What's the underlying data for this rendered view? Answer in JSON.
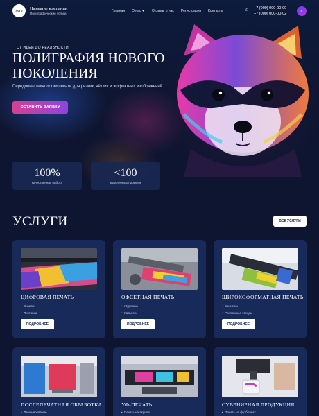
{
  "header": {
    "logo_text": "лого",
    "company_name": "Название компании",
    "company_subtitle": "Полиграфические услуги",
    "nav": [
      {
        "label": "Главная"
      },
      {
        "label": "О нас"
      },
      {
        "label": "Отзывы о нас"
      },
      {
        "label": "Регистрация"
      },
      {
        "label": "Контакты"
      }
    ],
    "phones": [
      "+7 (000) 000-00-00",
      "+7 (000) 000-00-02"
    ]
  },
  "hero": {
    "eyebrow": "ОТ ИДЕИ ДО РЕАЛЬНОСТИ",
    "title_line1": "ПОЛИГРАФИЯ НОВОГО",
    "title_line2": "ПОКОЛЕНИЯ",
    "description": "Передовые технологии печати для резких, чётких и эффектных изображений",
    "cta_label": "ОСТАВИТЬ ЗАЯВКУ"
  },
  "stats": [
    {
      "value": "100%",
      "label": "качественная работа"
    },
    {
      "value": "<100",
      "label": "выполненых проектов"
    }
  ],
  "services": {
    "title": "УСЛУГИ",
    "all_label": "ВСЕ УСЛУГИ",
    "cards": [
      {
        "title": "ЦИФРОВАЯ ПЕЧАТЬ",
        "items": [
          "Визитки",
          "Листовки"
        ],
        "button": "ПОДРОБНЕЕ"
      },
      {
        "title": "ОФСЕТНАЯ ПЕЧАТЬ",
        "items": [
          "Журналы",
          "Каталоги"
        ],
        "button": "ПОДРОБНЕЕ"
      },
      {
        "title": "ШИРОКОФОРМАТНАЯ ПЕЧАТЬ",
        "items": [
          "Баннеры",
          "Рекламные стенды"
        ],
        "button": "ПОДРОБНЕЕ"
      },
      {
        "title": "ПОСЛЕПЕЧАТНАЯ ОБРАБОТКА",
        "items": [
          "Ламинирование"
        ],
        "button": ""
      },
      {
        "title": "УФ-ПЕЧАТЬ",
        "items": [
          "Печать на акриле"
        ],
        "button": ""
      },
      {
        "title": "СУВЕНИРНАЯ ПРОДУКЦИЯ",
        "items": [
          "Печать на футболках"
        ],
        "button": ""
      }
    ]
  },
  "colors": {
    "background": "#0e1530",
    "card": "#172a5a",
    "cta_gradient_start": "#d83f8f",
    "cta_gradient_end": "#8d44e0"
  },
  "icons": {
    "phone": "phone-icon",
    "menu": "menu-icon",
    "dropdown": "chevron-down-icon"
  }
}
